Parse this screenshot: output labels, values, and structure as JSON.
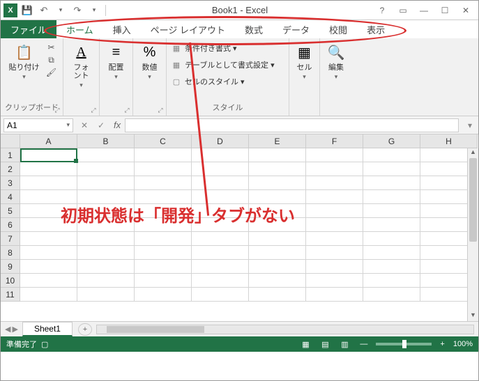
{
  "title": "Book1 - Excel",
  "qat": {
    "save": "save-icon",
    "undo": "undo-icon",
    "redo": "redo-icon"
  },
  "window": {
    "help": "?",
    "ribbon_opts": "▭",
    "min": "—",
    "max": "☐",
    "close": "✕"
  },
  "tabs": {
    "file": "ファイル",
    "home": "ホーム",
    "insert": "挿入",
    "page_layout": "ページ レイアウト",
    "formulas": "数式",
    "data": "データ",
    "review": "校閲",
    "view": "表示"
  },
  "ribbon": {
    "clipboard": {
      "paste": "貼り付け",
      "label": "クリップボード"
    },
    "font": {
      "label": "フォント"
    },
    "alignment": {
      "label": "配置"
    },
    "number": {
      "label": "数値"
    },
    "styles": {
      "conditional": "条件付き書式 ▾",
      "table_format": "テーブルとして書式設定 ▾",
      "cell_styles": "セルのスタイル ▾",
      "label": "スタイル"
    },
    "cells": {
      "label": "セル"
    },
    "editing": {
      "label": "編集"
    }
  },
  "namebox": "A1",
  "fx": "fx",
  "columns": [
    "A",
    "B",
    "C",
    "D",
    "E",
    "F",
    "G",
    "H"
  ],
  "rows": [
    "1",
    "2",
    "3",
    "4",
    "5",
    "6",
    "7",
    "8",
    "9",
    "10",
    "11"
  ],
  "sheet": {
    "name": "Sheet1",
    "add": "+"
  },
  "status": {
    "ready": "準備完了",
    "zoom": "100%"
  },
  "annotation": "初期状態は「開発」タブがない"
}
